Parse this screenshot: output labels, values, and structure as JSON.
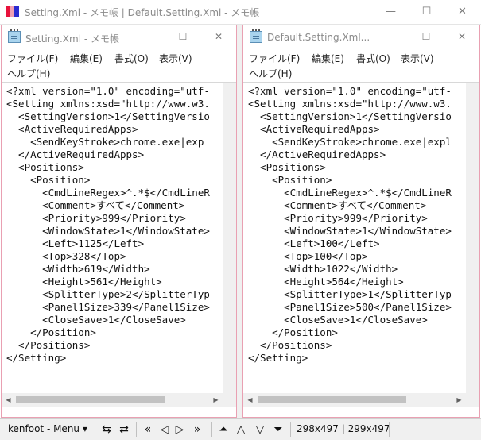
{
  "outer": {
    "title": "Setting.Xml - メモ帳 | Default.Setting.Xml - メモ帳",
    "minimize": "—",
    "maximize": "☐",
    "close": "✕"
  },
  "left": {
    "title": "Setting.Xml - メモ帳",
    "menu": {
      "file": "ファイル(F)",
      "edit": "編集(E)",
      "format": "書式(O)",
      "view": "表示(V)",
      "help": "ヘルプ(H)"
    },
    "lines": [
      "<?xml version=\"1.0\" encoding=\"utf-",
      "<Setting xmlns:xsd=\"http://www.w3.",
      "  <SettingVersion>1</SettingVersio",
      "  <ActiveRequiredApps>",
      "    <SendKeyStroke>chrome.exe|exp",
      "  </ActiveRequiredApps>",
      "  <Positions>",
      "    <Position>",
      "      <CmdLineRegex>^.*$</CmdLineR",
      "      <Comment>すべて</Comment>",
      "      <Priority>999</Priority>",
      "      <WindowState>1</WindowState>",
      "      <Left>1125</Left>",
      "      <Top>328</Top>",
      "      <Width>619</Width>",
      "      <Height>561</Height>",
      "      <SplitterType>2</SplitterTyp",
      "      <Panel1Size>339</Panel1Size>",
      "      <CloseSave>1</CloseSave>",
      "    </Position>",
      "  </Positions>",
      "</Setting>"
    ]
  },
  "right": {
    "title": "Default.Setting.Xml...",
    "menu": {
      "file": "ファイル(F)",
      "edit": "編集(E)",
      "format": "書式(O)",
      "view": "表示(V)",
      "help": "ヘルプ(H)"
    },
    "lines": [
      "<?xml version=\"1.0\" encoding=\"utf-",
      "<Setting xmlns:xsd=\"http://www.w3.",
      "  <SettingVersion>1</SettingVersio",
      "  <ActiveRequiredApps>",
      "    <SendKeyStroke>chrome.exe|expl",
      "  </ActiveRequiredApps>",
      "  <Positions>",
      "    <Position>",
      "      <CmdLineRegex>^.*$</CmdLineR",
      "      <Comment>すべて</Comment>",
      "      <Priority>999</Priority>",
      "      <WindowState>1</WindowState>",
      "      <Left>100</Left>",
      "      <Top>100</Top>",
      "      <Width>1022</Width>",
      "      <Height>564</Height>",
      "      <SplitterType>1</SplitterTyp",
      "      <Panel1Size>500</Panel1Size>",
      "      <CloseSave>1</CloseSave>",
      "    </Position>",
      "  </Positions>",
      "</Setting>"
    ]
  },
  "taskbar": {
    "menu_label": "kenfoot - Menu ▾",
    "size_readout": "298x497 | 299x497"
  }
}
